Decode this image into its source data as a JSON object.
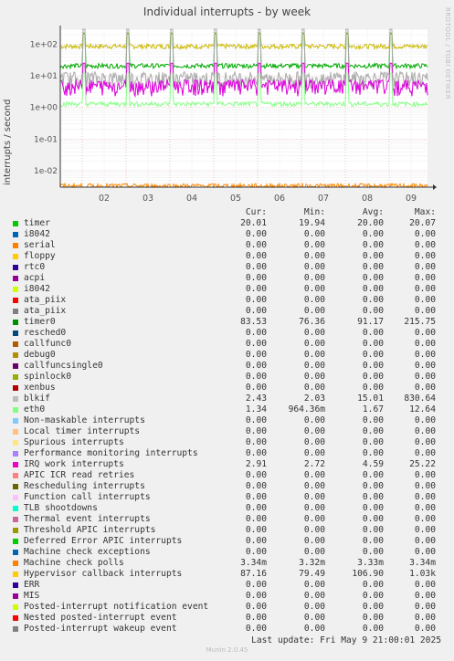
{
  "title": "Individual interrupts - by week",
  "side_label": "RRDTOOL / TOBI OETIKER",
  "footer": {
    "last_update": "Last update: Fri May  9 21:00:01 2025",
    "munin": "Munin 2.0.45"
  },
  "chart_data": {
    "type": "line",
    "title": "Individual interrupts - by week",
    "ylabel": "interrupts / second",
    "y_scale": "log",
    "ylim": [
      0.003,
      300
    ],
    "y_ticks": [
      "1e+02",
      "1e+01",
      "1e+00",
      "1e-01",
      "1e-02"
    ],
    "x_ticks": [
      "02",
      "03",
      "04",
      "05",
      "06",
      "07",
      "08",
      "09"
    ],
    "grid": true,
    "legend_position": "bottom",
    "series_plotted": [
      {
        "name": "Hypervisor callback interrupts",
        "color": "#ccbb00",
        "typical": 87,
        "spike": 230
      },
      {
        "name": "timer0",
        "color": "#00aa00",
        "typical": 21,
        "spike": 215
      },
      {
        "name": "blkif",
        "color": "#aaaaaa",
        "typical": 8,
        "spike": 830
      },
      {
        "name": "IRQ work interrupts",
        "color": "#dd00dd",
        "typical": 4.5,
        "spike": 25
      },
      {
        "name": "eth0",
        "color": "#88ff88",
        "typical": 1.3,
        "spike": 12
      },
      {
        "name": "Machine check polls",
        "color": "#ff8800",
        "typical": 0.0033,
        "spike": 0.0033
      }
    ]
  },
  "legend": {
    "headers": [
      "Cur:",
      "Min:",
      "Avg:",
      "Max:"
    ],
    "rows": [
      {
        "name": "timer",
        "color": "#00cc00",
        "cur": "20.01",
        "min": "19.94",
        "avg": "20.00",
        "max": "20.07"
      },
      {
        "name": "i8042",
        "color": "#0066b3",
        "cur": "0.00",
        "min": "0.00",
        "avg": "0.00",
        "max": "0.00"
      },
      {
        "name": "serial",
        "color": "#ff8000",
        "cur": "0.00",
        "min": "0.00",
        "avg": "0.00",
        "max": "0.00"
      },
      {
        "name": "floppy",
        "color": "#ffcc00",
        "cur": "0.00",
        "min": "0.00",
        "avg": "0.00",
        "max": "0.00"
      },
      {
        "name": "rtc0",
        "color": "#330099",
        "cur": "0.00",
        "min": "0.00",
        "avg": "0.00",
        "max": "0.00"
      },
      {
        "name": "acpi",
        "color": "#990099",
        "cur": "0.00",
        "min": "0.00",
        "avg": "0.00",
        "max": "0.00"
      },
      {
        "name": "i8042",
        "color": "#ccff00",
        "cur": "0.00",
        "min": "0.00",
        "avg": "0.00",
        "max": "0.00"
      },
      {
        "name": "ata_piix",
        "color": "#ff0000",
        "cur": "0.00",
        "min": "0.00",
        "avg": "0.00",
        "max": "0.00"
      },
      {
        "name": "ata_piix",
        "color": "#808080",
        "cur": "0.00",
        "min": "0.00",
        "avg": "0.00",
        "max": "0.00"
      },
      {
        "name": "timer0",
        "color": "#008f00",
        "cur": "83.53",
        "min": "76.36",
        "avg": "91.17",
        "max": "215.75"
      },
      {
        "name": "resched0",
        "color": "#00487d",
        "cur": "0.00",
        "min": "0.00",
        "avg": "0.00",
        "max": "0.00"
      },
      {
        "name": "callfunc0",
        "color": "#b35a00",
        "cur": "0.00",
        "min": "0.00",
        "avg": "0.00",
        "max": "0.00"
      },
      {
        "name": "debug0",
        "color": "#b38f00",
        "cur": "0.00",
        "min": "0.00",
        "avg": "0.00",
        "max": "0.00"
      },
      {
        "name": "callfuncsingle0",
        "color": "#6b006b",
        "cur": "0.00",
        "min": "0.00",
        "avg": "0.00",
        "max": "0.00"
      },
      {
        "name": "spinlock0",
        "color": "#8fb300",
        "cur": "0.00",
        "min": "0.00",
        "avg": "0.00",
        "max": "0.00"
      },
      {
        "name": "xenbus",
        "color": "#b30000",
        "cur": "0.00",
        "min": "0.00",
        "avg": "0.00",
        "max": "0.00"
      },
      {
        "name": "blkif",
        "color": "#bebebe",
        "cur": "2.43",
        "min": "2.03",
        "avg": "15.01",
        "max": "830.64"
      },
      {
        "name": "eth0",
        "color": "#80ff80",
        "cur": "1.34",
        "min": "964.36m",
        "avg": "1.67",
        "max": "12.64"
      },
      {
        "name": "Non-maskable interrupts",
        "color": "#80c9ff",
        "cur": "0.00",
        "min": "0.00",
        "avg": "0.00",
        "max": "0.00"
      },
      {
        "name": "Local timer interrupts",
        "color": "#ffc080",
        "cur": "0.00",
        "min": "0.00",
        "avg": "0.00",
        "max": "0.00"
      },
      {
        "name": "Spurious interrupts",
        "color": "#ffe680",
        "cur": "0.00",
        "min": "0.00",
        "avg": "0.00",
        "max": "0.00"
      },
      {
        "name": "Performance monitoring interrupts",
        "color": "#aa80ff",
        "cur": "0.00",
        "min": "0.00",
        "avg": "0.00",
        "max": "0.00"
      },
      {
        "name": "IRQ work interrupts",
        "color": "#ee00cc",
        "cur": "2.91",
        "min": "2.72",
        "avg": "4.59",
        "max": "25.22"
      },
      {
        "name": "APIC ICR read retries",
        "color": "#ff8080",
        "cur": "0.00",
        "min": "0.00",
        "avg": "0.00",
        "max": "0.00"
      },
      {
        "name": "Rescheduling interrupts",
        "color": "#666600",
        "cur": "0.00",
        "min": "0.00",
        "avg": "0.00",
        "max": "0.00"
      },
      {
        "name": "Function call interrupts",
        "color": "#ffbfff",
        "cur": "0.00",
        "min": "0.00",
        "avg": "0.00",
        "max": "0.00"
      },
      {
        "name": "TLB shootdowns",
        "color": "#00ffcc",
        "cur": "0.00",
        "min": "0.00",
        "avg": "0.00",
        "max": "0.00"
      },
      {
        "name": "Thermal event interrupts",
        "color": "#cc6699",
        "cur": "0.00",
        "min": "0.00",
        "avg": "0.00",
        "max": "0.00"
      },
      {
        "name": "Threshold APIC interrupts",
        "color": "#999900",
        "cur": "0.00",
        "min": "0.00",
        "avg": "0.00",
        "max": "0.00"
      },
      {
        "name": "Deferred Error APIC interrupts",
        "color": "#00cc00",
        "cur": "0.00",
        "min": "0.00",
        "avg": "0.00",
        "max": "0.00"
      },
      {
        "name": "Machine check exceptions",
        "color": "#0066b3",
        "cur": "0.00",
        "min": "0.00",
        "avg": "0.00",
        "max": "0.00"
      },
      {
        "name": "Machine check polls",
        "color": "#ff8000",
        "cur": "3.34m",
        "min": "3.32m",
        "avg": "3.33m",
        "max": "3.34m"
      },
      {
        "name": "Hypervisor callback interrupts",
        "color": "#ffcc00",
        "cur": "87.16",
        "min": "79.49",
        "avg": "106.90",
        "max": "1.03k"
      },
      {
        "name": "ERR",
        "color": "#330099",
        "cur": "0.00",
        "min": "0.00",
        "avg": "0.00",
        "max": "0.00"
      },
      {
        "name": "MIS",
        "color": "#990099",
        "cur": "0.00",
        "min": "0.00",
        "avg": "0.00",
        "max": "0.00"
      },
      {
        "name": "Posted-interrupt notification event",
        "color": "#ccff00",
        "cur": "0.00",
        "min": "0.00",
        "avg": "0.00",
        "max": "0.00"
      },
      {
        "name": "Nested posted-interrupt event",
        "color": "#ff0000",
        "cur": "0.00",
        "min": "0.00",
        "avg": "0.00",
        "max": "0.00"
      },
      {
        "name": "Posted-interrupt wakeup event",
        "color": "#808080",
        "cur": "0.00",
        "min": "0.00",
        "avg": "0.00",
        "max": "0.00"
      }
    ]
  }
}
